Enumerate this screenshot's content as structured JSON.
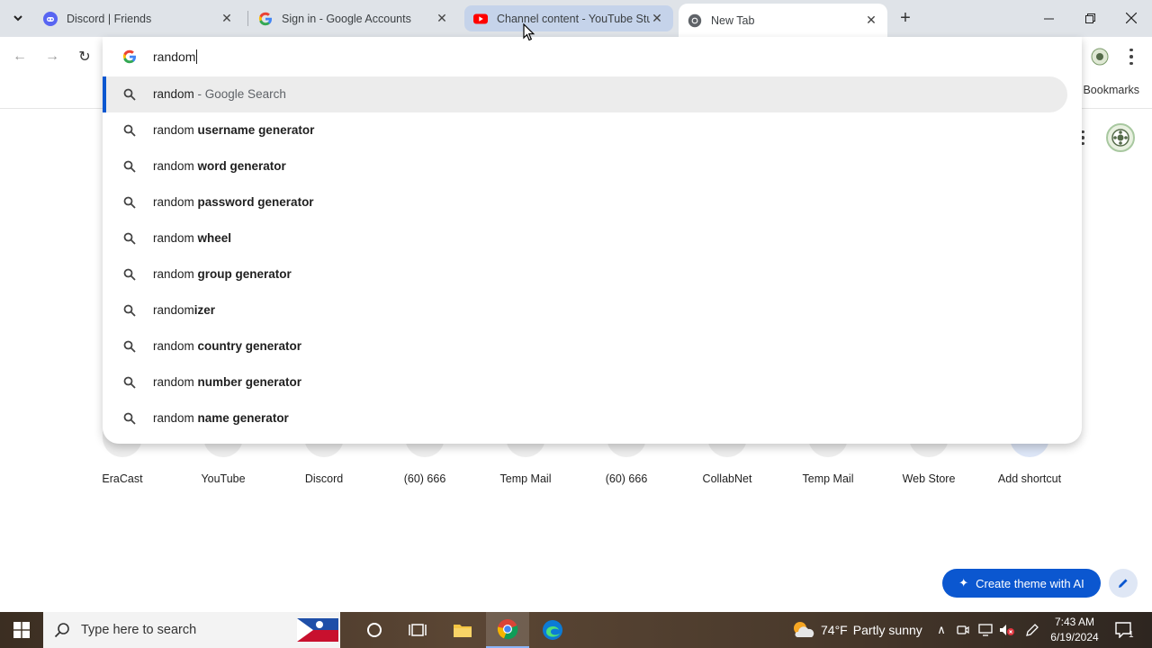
{
  "tabs": [
    {
      "title": "Discord | Friends",
      "favicon": "discord-icon"
    },
    {
      "title": "Sign in - Google Accounts",
      "favicon": "google-icon"
    },
    {
      "title": "Channel content - YouTube Studio",
      "favicon": "youtube-icon"
    },
    {
      "title": "New Tab",
      "favicon": "chrome-icon"
    }
  ],
  "bookmarks": {
    "all_label": "All Bookmarks"
  },
  "omnibox": {
    "query": "random",
    "suggestions": [
      {
        "prefix": "random",
        "suffix": "",
        "tail": " - Google Search"
      },
      {
        "prefix": "random ",
        "suffix": "username generator"
      },
      {
        "prefix": "random ",
        "suffix": "word generator"
      },
      {
        "prefix": "random ",
        "suffix": "password generator"
      },
      {
        "prefix": "random ",
        "suffix": "wheel"
      },
      {
        "prefix": "random ",
        "suffix": "group generator"
      },
      {
        "prefix": "random",
        "suffix": "izer"
      },
      {
        "prefix": "random ",
        "suffix": "country generator"
      },
      {
        "prefix": "random ",
        "suffix": "number generator"
      },
      {
        "prefix": "random ",
        "suffix": "name generator"
      }
    ]
  },
  "shortcuts": [
    {
      "label": "EraCast",
      "color": "#d93025"
    },
    {
      "label": "YouTube",
      "color": "#ff0000"
    },
    {
      "label": "Discord",
      "color": "#5865f2"
    },
    {
      "label": "(60) 666",
      "color": "#bdbdbd"
    },
    {
      "label": "Temp Mail",
      "color": "#188038"
    },
    {
      "label": "(60) 666",
      "color": "#bdbdbd"
    },
    {
      "label": "CollabNet",
      "color": "#7b4bb5"
    },
    {
      "label": "Temp Mail",
      "color": "#5865f2"
    },
    {
      "label": "Web Store",
      "color": "#34a853"
    },
    {
      "label": "Add shortcut",
      "color": "#c6d5f5"
    }
  ],
  "create_theme_label": "Create theme with AI",
  "taskbar": {
    "search_placeholder": "Type here to search",
    "weather_temp": "74°F",
    "weather_desc": "Partly sunny",
    "time": "7:43 AM",
    "date": "6/19/2024",
    "notification_count": "1"
  }
}
